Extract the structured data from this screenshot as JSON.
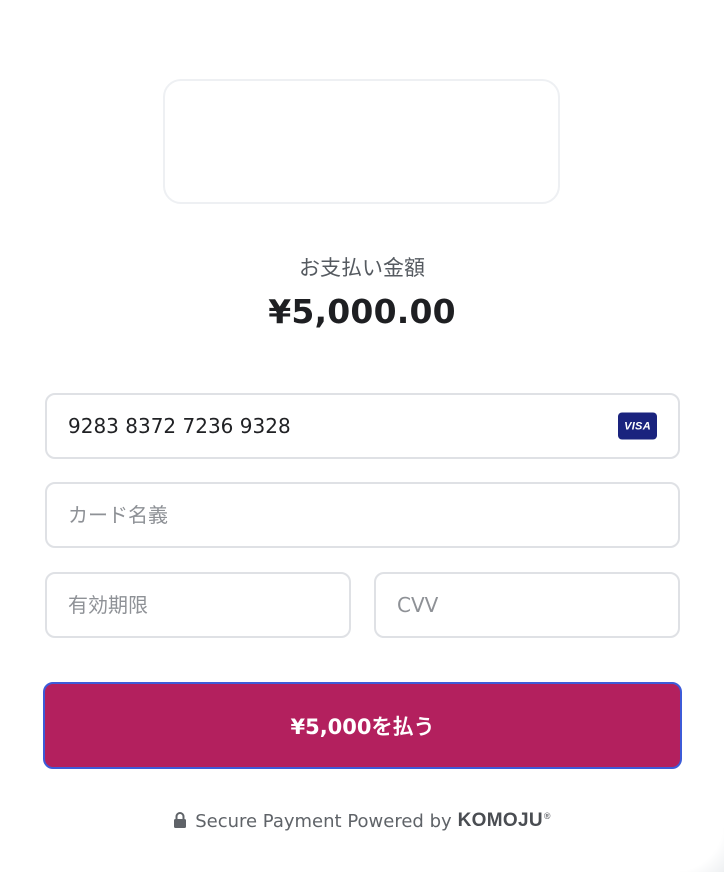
{
  "payment": {
    "amount_label": "お支払い金額",
    "amount_value": "¥5,000.00"
  },
  "form": {
    "card_number": {
      "value": "9283 8372 7236 9328",
      "brand": "VISA"
    },
    "cardholder": {
      "placeholder": "カード名義"
    },
    "expiry": {
      "placeholder": "有効期限"
    },
    "cvv": {
      "placeholder": "CVV"
    },
    "submit_label": "¥5,000を払う"
  },
  "footer": {
    "text": "Secure Payment Powered by",
    "brand": "KOMOJU",
    "brand_mark": "®",
    "icon": "lock-icon"
  },
  "colors": {
    "accent": "#b3205e",
    "visa": "#1a237e"
  }
}
